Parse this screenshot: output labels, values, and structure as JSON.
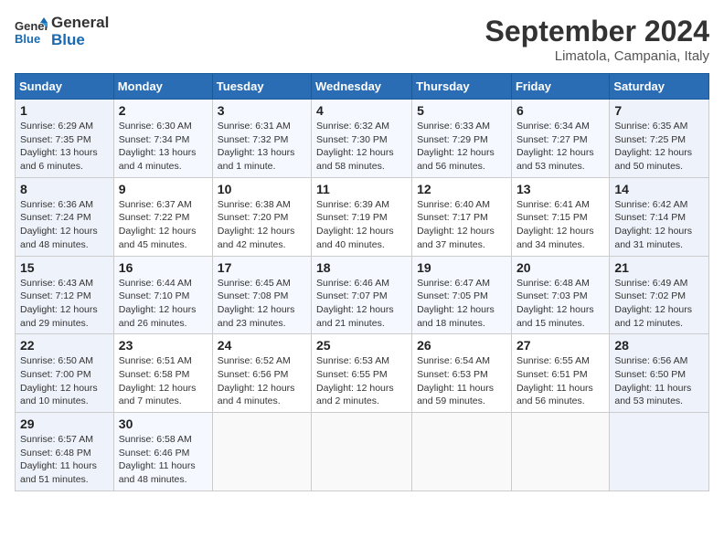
{
  "header": {
    "logo_general": "General",
    "logo_blue": "Blue",
    "month_title": "September 2024",
    "location": "Limatola, Campania, Italy"
  },
  "weekdays": [
    "Sunday",
    "Monday",
    "Tuesday",
    "Wednesday",
    "Thursday",
    "Friday",
    "Saturday"
  ],
  "weeks": [
    [
      {
        "day": 1,
        "info": "Sunrise: 6:29 AM\nSunset: 7:35 PM\nDaylight: 13 hours\nand 6 minutes."
      },
      {
        "day": 2,
        "info": "Sunrise: 6:30 AM\nSunset: 7:34 PM\nDaylight: 13 hours\nand 4 minutes."
      },
      {
        "day": 3,
        "info": "Sunrise: 6:31 AM\nSunset: 7:32 PM\nDaylight: 13 hours\nand 1 minute."
      },
      {
        "day": 4,
        "info": "Sunrise: 6:32 AM\nSunset: 7:30 PM\nDaylight: 12 hours\nand 58 minutes."
      },
      {
        "day": 5,
        "info": "Sunrise: 6:33 AM\nSunset: 7:29 PM\nDaylight: 12 hours\nand 56 minutes."
      },
      {
        "day": 6,
        "info": "Sunrise: 6:34 AM\nSunset: 7:27 PM\nDaylight: 12 hours\nand 53 minutes."
      },
      {
        "day": 7,
        "info": "Sunrise: 6:35 AM\nSunset: 7:25 PM\nDaylight: 12 hours\nand 50 minutes."
      }
    ],
    [
      {
        "day": 8,
        "info": "Sunrise: 6:36 AM\nSunset: 7:24 PM\nDaylight: 12 hours\nand 48 minutes."
      },
      {
        "day": 9,
        "info": "Sunrise: 6:37 AM\nSunset: 7:22 PM\nDaylight: 12 hours\nand 45 minutes."
      },
      {
        "day": 10,
        "info": "Sunrise: 6:38 AM\nSunset: 7:20 PM\nDaylight: 12 hours\nand 42 minutes."
      },
      {
        "day": 11,
        "info": "Sunrise: 6:39 AM\nSunset: 7:19 PM\nDaylight: 12 hours\nand 40 minutes."
      },
      {
        "day": 12,
        "info": "Sunrise: 6:40 AM\nSunset: 7:17 PM\nDaylight: 12 hours\nand 37 minutes."
      },
      {
        "day": 13,
        "info": "Sunrise: 6:41 AM\nSunset: 7:15 PM\nDaylight: 12 hours\nand 34 minutes."
      },
      {
        "day": 14,
        "info": "Sunrise: 6:42 AM\nSunset: 7:14 PM\nDaylight: 12 hours\nand 31 minutes."
      }
    ],
    [
      {
        "day": 15,
        "info": "Sunrise: 6:43 AM\nSunset: 7:12 PM\nDaylight: 12 hours\nand 29 minutes."
      },
      {
        "day": 16,
        "info": "Sunrise: 6:44 AM\nSunset: 7:10 PM\nDaylight: 12 hours\nand 26 minutes."
      },
      {
        "day": 17,
        "info": "Sunrise: 6:45 AM\nSunset: 7:08 PM\nDaylight: 12 hours\nand 23 minutes."
      },
      {
        "day": 18,
        "info": "Sunrise: 6:46 AM\nSunset: 7:07 PM\nDaylight: 12 hours\nand 21 minutes."
      },
      {
        "day": 19,
        "info": "Sunrise: 6:47 AM\nSunset: 7:05 PM\nDaylight: 12 hours\nand 18 minutes."
      },
      {
        "day": 20,
        "info": "Sunrise: 6:48 AM\nSunset: 7:03 PM\nDaylight: 12 hours\nand 15 minutes."
      },
      {
        "day": 21,
        "info": "Sunrise: 6:49 AM\nSunset: 7:02 PM\nDaylight: 12 hours\nand 12 minutes."
      }
    ],
    [
      {
        "day": 22,
        "info": "Sunrise: 6:50 AM\nSunset: 7:00 PM\nDaylight: 12 hours\nand 10 minutes."
      },
      {
        "day": 23,
        "info": "Sunrise: 6:51 AM\nSunset: 6:58 PM\nDaylight: 12 hours\nand 7 minutes."
      },
      {
        "day": 24,
        "info": "Sunrise: 6:52 AM\nSunset: 6:56 PM\nDaylight: 12 hours\nand 4 minutes."
      },
      {
        "day": 25,
        "info": "Sunrise: 6:53 AM\nSunset: 6:55 PM\nDaylight: 12 hours\nand 2 minutes."
      },
      {
        "day": 26,
        "info": "Sunrise: 6:54 AM\nSunset: 6:53 PM\nDaylight: 11 hours\nand 59 minutes."
      },
      {
        "day": 27,
        "info": "Sunrise: 6:55 AM\nSunset: 6:51 PM\nDaylight: 11 hours\nand 56 minutes."
      },
      {
        "day": 28,
        "info": "Sunrise: 6:56 AM\nSunset: 6:50 PM\nDaylight: 11 hours\nand 53 minutes."
      }
    ],
    [
      {
        "day": 29,
        "info": "Sunrise: 6:57 AM\nSunset: 6:48 PM\nDaylight: 11 hours\nand 51 minutes."
      },
      {
        "day": 30,
        "info": "Sunrise: 6:58 AM\nSunset: 6:46 PM\nDaylight: 11 hours\nand 48 minutes."
      },
      {
        "day": null,
        "info": ""
      },
      {
        "day": null,
        "info": ""
      },
      {
        "day": null,
        "info": ""
      },
      {
        "day": null,
        "info": ""
      },
      {
        "day": null,
        "info": ""
      }
    ]
  ]
}
